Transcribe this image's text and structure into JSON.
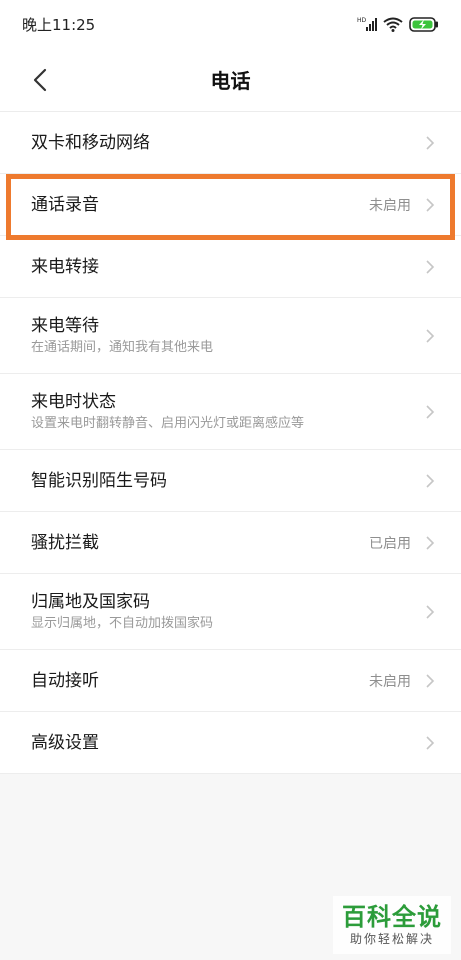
{
  "status_bar": {
    "time": "晚上11:25",
    "signal_tag": "HD"
  },
  "header": {
    "title": "电话"
  },
  "settings": [
    {
      "title": "双卡和移动网络",
      "subtitle": "",
      "value": ""
    },
    {
      "title": "通话录音",
      "subtitle": "",
      "value": "未启用"
    },
    {
      "title": "来电转接",
      "subtitle": "",
      "value": ""
    },
    {
      "title": "来电等待",
      "subtitle": "在通话期间，通知我有其他来电",
      "value": ""
    },
    {
      "title": "来电时状态",
      "subtitle": "设置来电时翻转静音、启用闪光灯或距离感应等",
      "value": ""
    },
    {
      "title": "智能识别陌生号码",
      "subtitle": "",
      "value": ""
    },
    {
      "title": "骚扰拦截",
      "subtitle": "",
      "value": "已启用"
    },
    {
      "title": "归属地及国家码",
      "subtitle": "显示归属地，不自动加拨国家码",
      "value": ""
    },
    {
      "title": "自动接听",
      "subtitle": "",
      "value": "未启用"
    },
    {
      "title": "高级设置",
      "subtitle": "",
      "value": ""
    }
  ],
  "watermark": {
    "main": "百科全说",
    "sub": "助你轻松解决"
  },
  "colors": {
    "highlight": "#ee7a2e",
    "watermark": "#2c9c3a",
    "battery": "#3cc43c"
  }
}
